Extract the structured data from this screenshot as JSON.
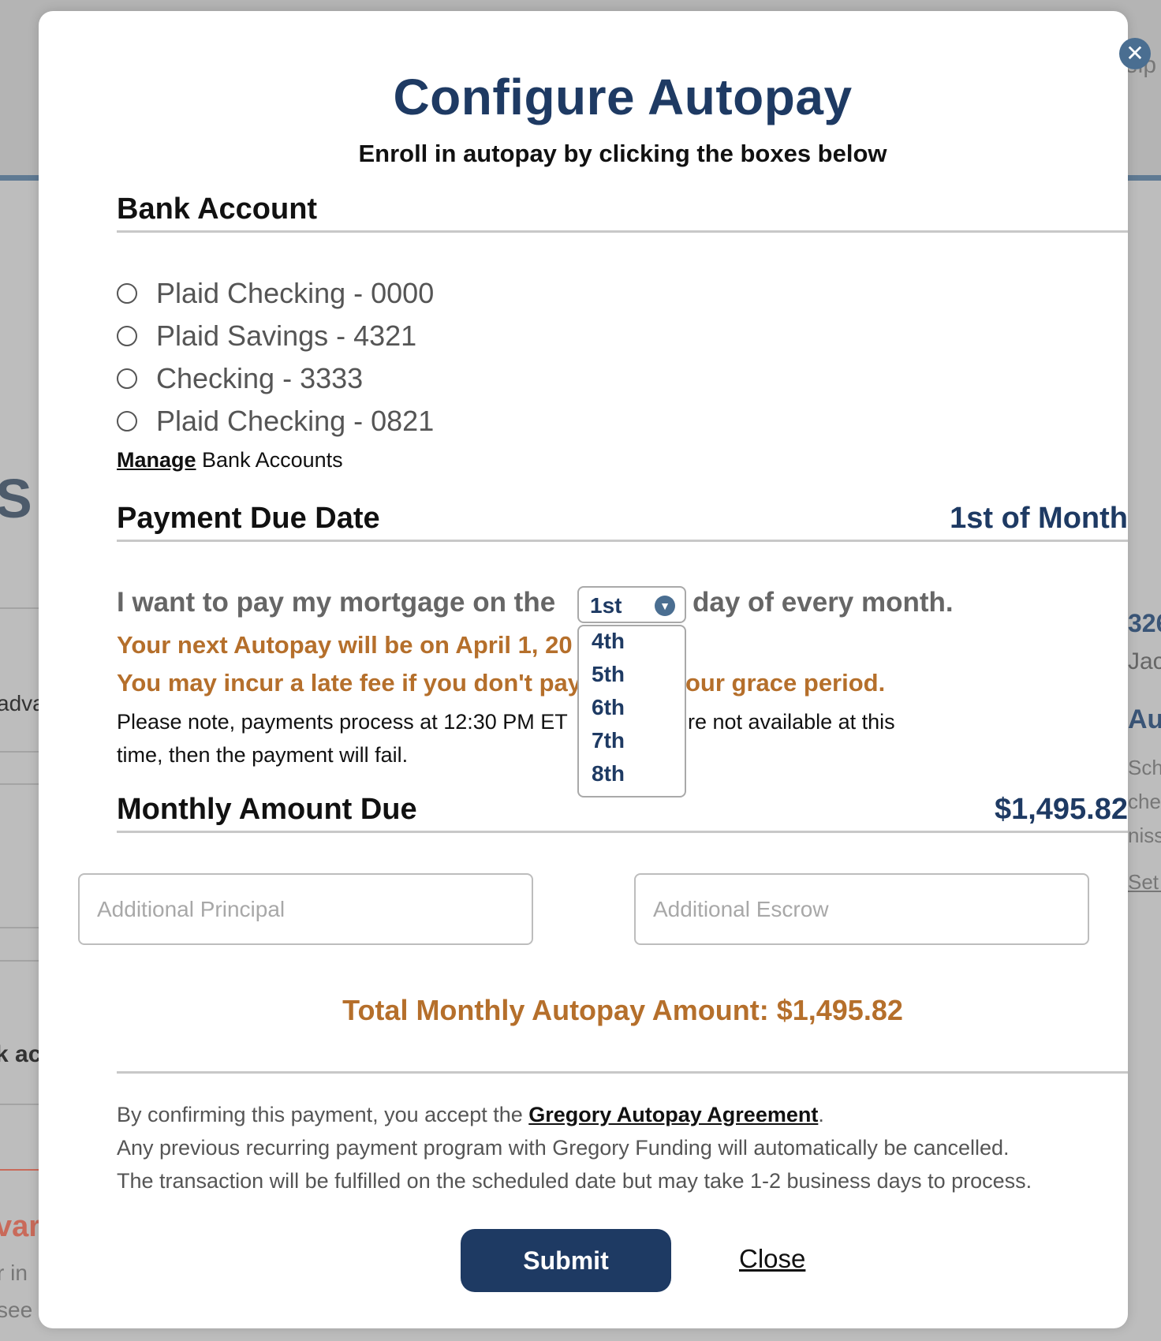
{
  "background": {
    "help_fragment": "elp",
    "fragments": [
      "S",
      "adva",
      "k ac",
      "var",
      "r in",
      "see",
      "326",
      "Jac",
      "Aut",
      "Sche",
      "ched",
      "niss",
      "Set U"
    ]
  },
  "modal": {
    "close_icon_glyph": "✕",
    "title": "Configure Autopay",
    "subtitle": "Enroll in autopay by clicking the boxes below",
    "bank_account": {
      "heading": "Bank Account",
      "accounts": [
        "Plaid Checking - 0000",
        "Plaid Savings - 4321",
        "Checking - 3333",
        "Plaid Checking - 0821"
      ],
      "manage_link": "Manage",
      "manage_suffix": " Bank Accounts"
    },
    "payment_due_date": {
      "heading": "Payment Due Date",
      "value": "1st of Month",
      "sentence_before": "I want to pay my mortgage on the",
      "sentence_after": "day of every month.",
      "selected_day": "1st",
      "dropdown_options": [
        "4th",
        "5th",
        "6th",
        "7th",
        "8th"
      ],
      "next_autopay": "Your next Autopay will be on April 1, 20",
      "late_fee_warning_left": "You may incur a late fee if you don't pay",
      "late_fee_warning_right": "our grace period.",
      "note_left": "Please note, payments process at 12:30 PM ET",
      "note_right": "re not available at this",
      "note_line2": "time, then the payment will fail."
    },
    "monthly_amount": {
      "heading": "Monthly Amount Due",
      "value": "$1,495.82",
      "additional_principal_placeholder": "Additional Principal",
      "additional_escrow_placeholder": "Additional Escrow"
    },
    "total": "Total Monthly Autopay Amount: $1,495.82",
    "legal": {
      "line1_prefix": "By confirming this payment, you accept the ",
      "agreement_link": "Gregory Autopay Agreement",
      "line1_suffix": ".",
      "line2": "Any previous recurring payment program with Gregory Funding will automatically be cancelled.",
      "line3": "The transaction will be fulfilled on the scheduled date but may take 1-2 business days to process."
    },
    "submit_label": "Submit",
    "close_label": "Close"
  },
  "colors": {
    "navy": "#1e3a63",
    "orange": "#b56f2b",
    "icon_blue": "#4a6e91"
  }
}
